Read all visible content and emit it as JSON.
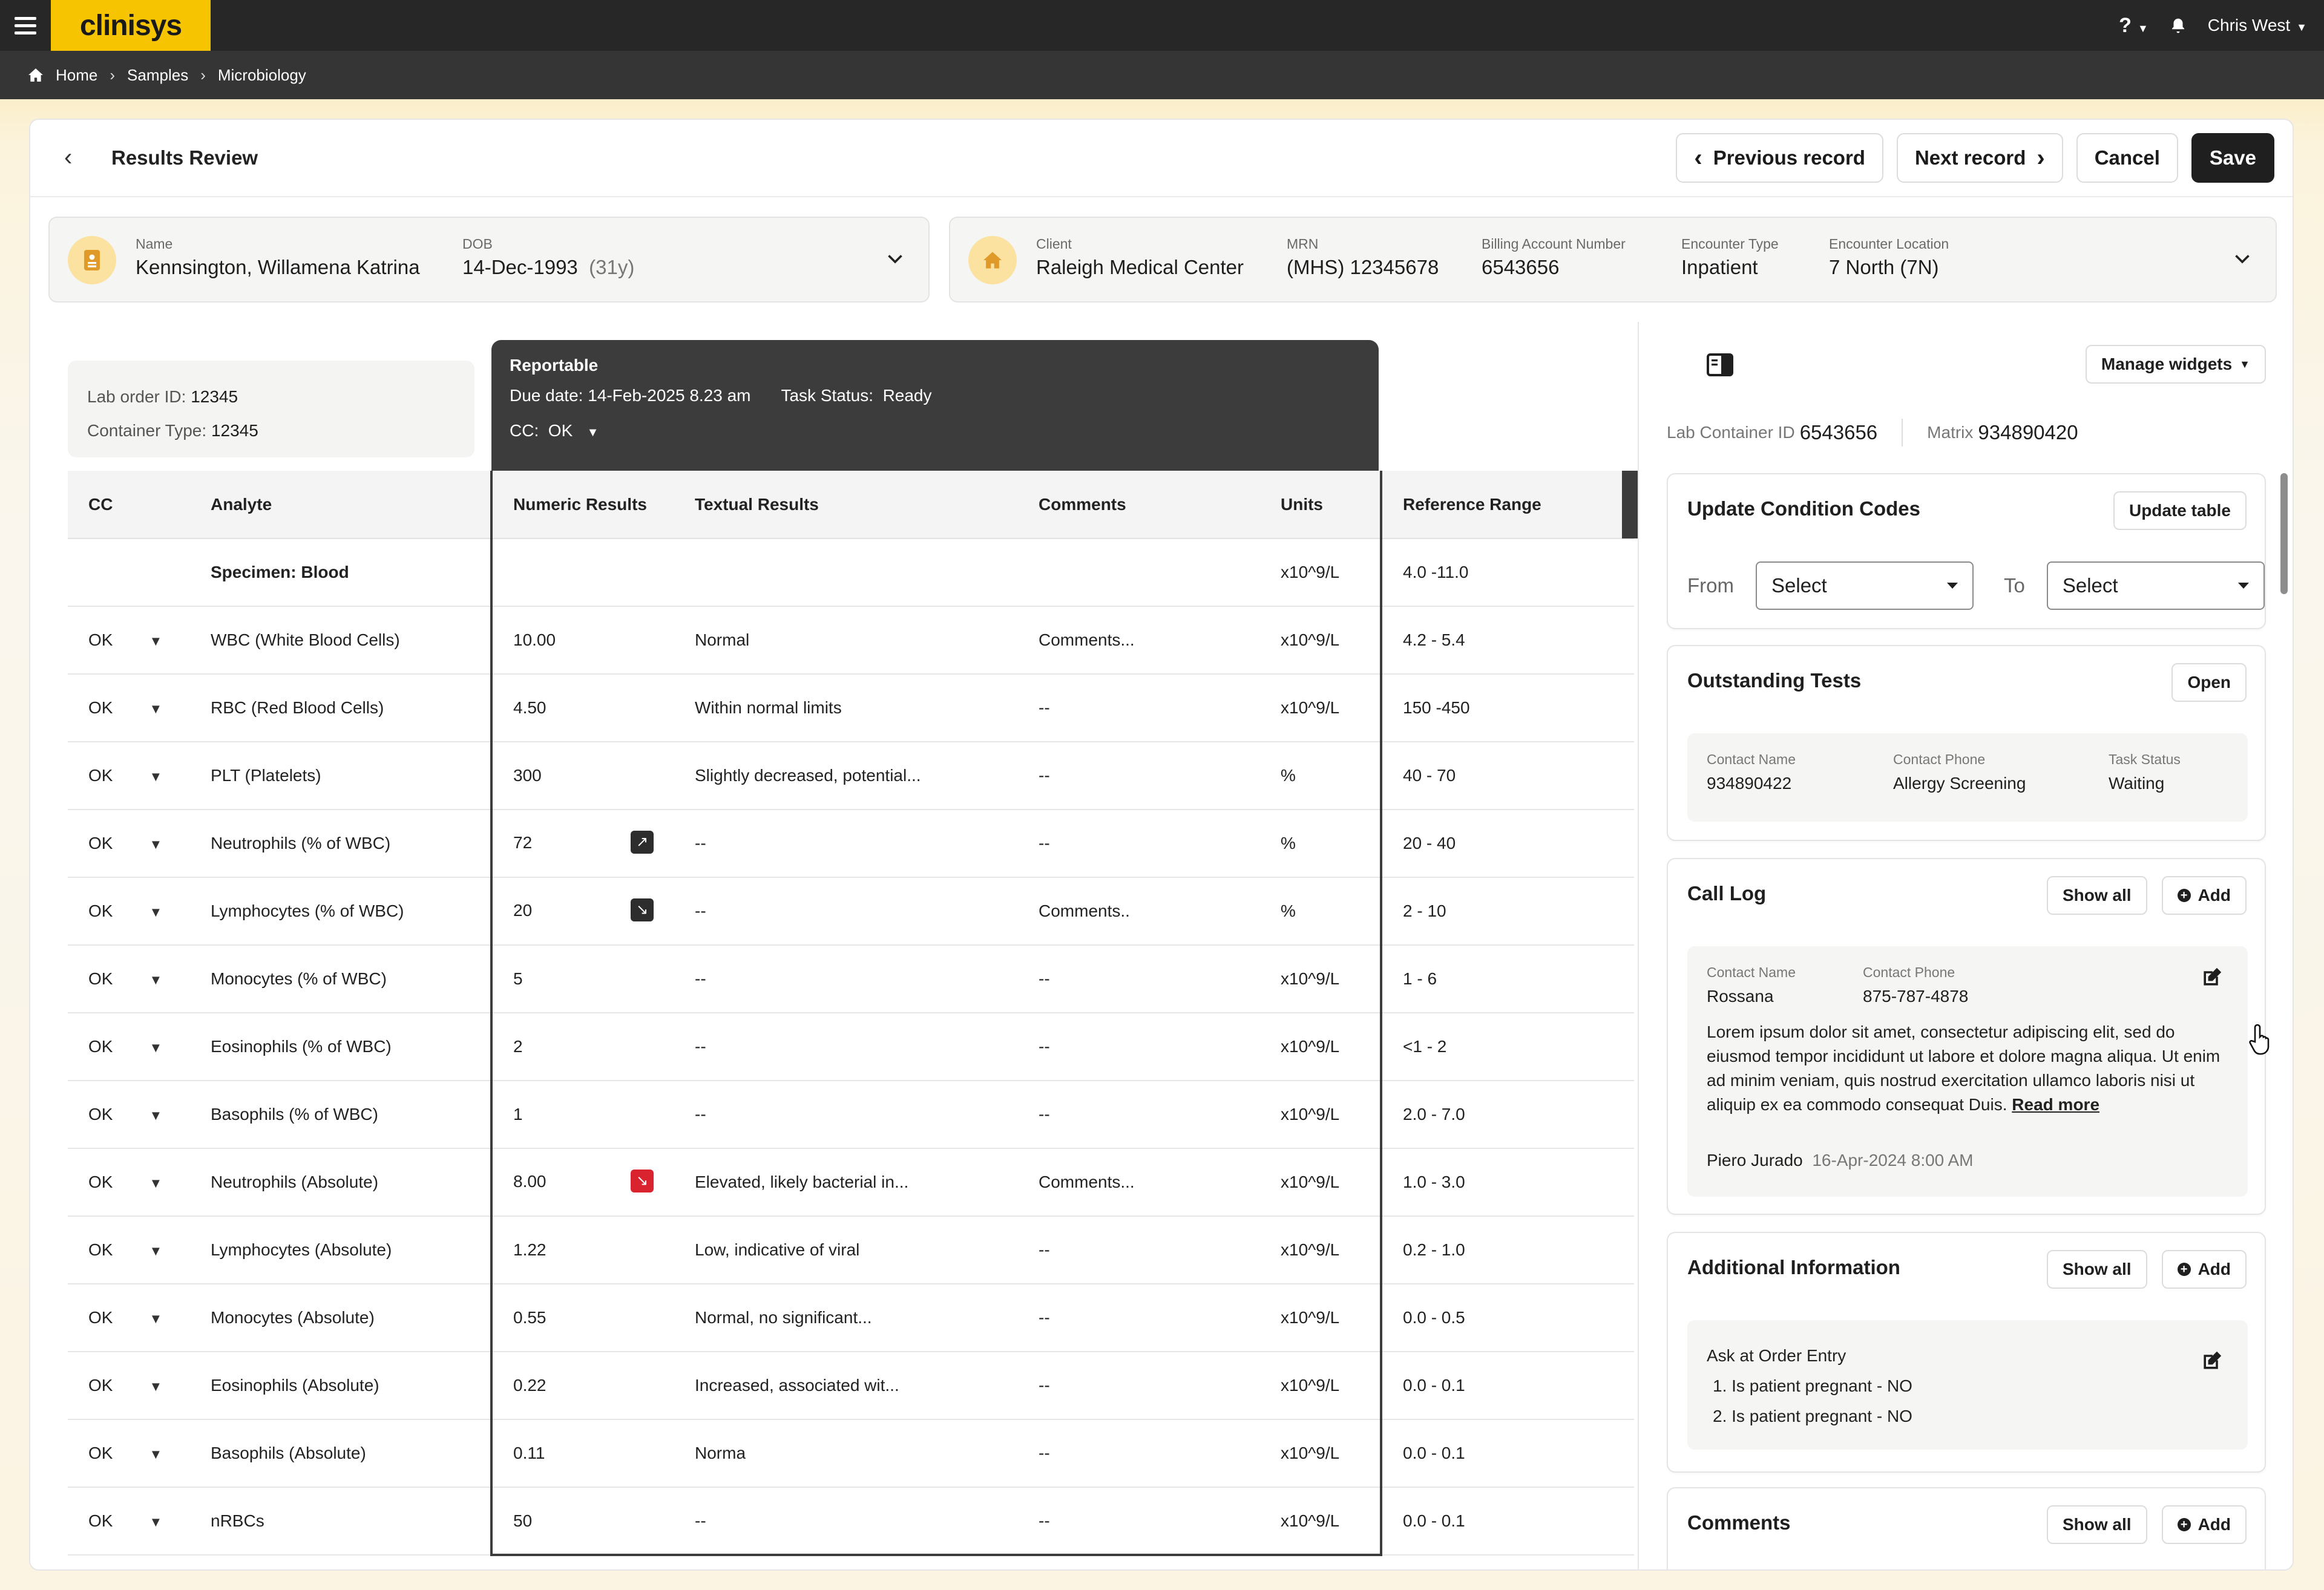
{
  "topbar": {
    "brand": "clinisys",
    "help": "?",
    "user": "Chris West"
  },
  "breadcrumb": [
    "Home",
    "Samples",
    "Microbiology"
  ],
  "header": {
    "title": "Results Review",
    "prev": "Previous record",
    "next": "Next record",
    "cancel": "Cancel",
    "save": "Save"
  },
  "patient": {
    "name_label": "Name",
    "name": "Kennsington, Willamena Katrina",
    "dob_label": "DOB",
    "dob": "14-Dec-1993",
    "age": "(31y)"
  },
  "client": {
    "client_label": "Client",
    "client": "Raleigh Medical Center",
    "mrn_label": "MRN",
    "mrn": "(MHS) 12345678",
    "billing_label": "Billing Account Number",
    "billing": "6543656",
    "enc_type_label": "Encounter Type",
    "enc_type": "Inpatient",
    "enc_loc_label": "Encounter Location",
    "enc_loc": "7 North (7N)"
  },
  "order": {
    "lab_order_label": "Lab order ID:",
    "lab_order": "12345",
    "container_label": "Container Type:",
    "container": "12345"
  },
  "reportable": {
    "title": "Reportable",
    "due_label": "Due date:",
    "due": "14-Feb-2025 8.23 am",
    "task_label": "Task Status:",
    "task": "Ready",
    "cc_label": "CC:",
    "cc": "OK"
  },
  "table": {
    "headers": [
      "CC",
      "Analyte",
      "Numeric Results",
      "Textual Results",
      "Comments",
      "Units",
      "Reference Range"
    ],
    "rows": [
      {
        "cc": "",
        "analyte": "Specimen: Blood",
        "numeric": "",
        "flag": "",
        "textual": "",
        "comments": "",
        "units": "x10^9/L",
        "range": "4.0 -11.0"
      },
      {
        "cc": "OK",
        "analyte": "WBC (White Blood Cells)",
        "numeric": "10.00",
        "flag": "",
        "textual": "Normal",
        "comments": "Comments...",
        "units": "x10^9/L",
        "range": "4.2 - 5.4"
      },
      {
        "cc": "OK",
        "analyte": "RBC (Red Blood Cells)",
        "numeric": "4.50",
        "flag": "",
        "textual": "Within normal limits",
        "comments": "--",
        "units": "x10^9/L",
        "range": "150 -450"
      },
      {
        "cc": "OK",
        "analyte": "PLT (Platelets)",
        "numeric": "300",
        "flag": "",
        "textual": "Slightly decreased, potential...",
        "comments": "--",
        "units": "%",
        "range": "40 - 70"
      },
      {
        "cc": "OK",
        "analyte": "Neutrophils (% of WBC)",
        "numeric": "72",
        "flag": "up-dark",
        "textual": "--",
        "comments": "--",
        "units": "%",
        "range": "20 - 40"
      },
      {
        "cc": "OK",
        "analyte": "Lymphocytes (% of WBC)",
        "numeric": "20",
        "flag": "down-dark",
        "textual": "--",
        "comments": "Comments..",
        "units": "%",
        "range": "2 - 10"
      },
      {
        "cc": "OK",
        "analyte": "Monocytes (% of WBC)",
        "numeric": "5",
        "flag": "",
        "textual": "--",
        "comments": "--",
        "units": "x10^9/L",
        "range": "1 - 6"
      },
      {
        "cc": "OK",
        "analyte": "Eosinophils (% of WBC)",
        "numeric": "2",
        "flag": "",
        "textual": "--",
        "comments": "--",
        "units": "x10^9/L",
        "range": "<1 - 2"
      },
      {
        "cc": "OK",
        "analyte": "Basophils (% of WBC)",
        "numeric": "1",
        "flag": "",
        "textual": "--",
        "comments": "--",
        "units": "x10^9/L",
        "range": "2.0 - 7.0"
      },
      {
        "cc": "OK",
        "analyte": "Neutrophils (Absolute)",
        "numeric": "8.00",
        "flag": "down-red",
        "textual": "Elevated, likely bacterial in...",
        "comments": "Comments...",
        "units": "x10^9/L",
        "range": "1.0 - 3.0"
      },
      {
        "cc": "OK",
        "analyte": "Lymphocytes (Absolute)",
        "numeric": "1.22",
        "flag": "",
        "textual": "Low, indicative of viral",
        "comments": "--",
        "units": "x10^9/L",
        "range": "0.2 - 1.0"
      },
      {
        "cc": "OK",
        "analyte": "Monocytes (Absolute)",
        "numeric": "0.55",
        "flag": "",
        "textual": "Normal, no significant...",
        "comments": "--",
        "units": "x10^9/L",
        "range": "0.0 - 0.5"
      },
      {
        "cc": "OK",
        "analyte": "Eosinophils (Absolute)",
        "numeric": "0.22",
        "flag": "",
        "textual": "Increased, associated wit...",
        "comments": "--",
        "units": "x10^9/L",
        "range": "0.0 - 0.1"
      },
      {
        "cc": "OK",
        "analyte": "Basophils (Absolute)",
        "numeric": "0.11",
        "flag": "",
        "textual": "Norma",
        "comments": "--",
        "units": "x10^9/L",
        "range": "0.0 - 0.1"
      },
      {
        "cc": "OK",
        "analyte": "nRBCs",
        "numeric": "50",
        "flag": "",
        "textual": "--",
        "comments": "--",
        "units": "x10^9/L",
        "range": "0.0 - 0.1"
      }
    ]
  },
  "sidebar": {
    "manage": "Manage widgets",
    "container_label": "Lab Container ID",
    "container": "6543656",
    "matrix_label": "Matrix",
    "matrix": "934890420",
    "condition": {
      "title": "Update Condition Codes",
      "update": "Update table",
      "from": "From",
      "to": "To",
      "from_value": "Select",
      "to_value": "Select"
    },
    "outstanding": {
      "title": "Outstanding Tests",
      "open": "Open",
      "c1_label": "Contact Name",
      "c1": "934890422",
      "c2_label": "Contact Phone",
      "c2": "Allergy Screening",
      "c3_label": "Task Status",
      "c3": "Waiting"
    },
    "calllog": {
      "title": "Call Log",
      "show_all": "Show all",
      "add": "Add",
      "name_label": "Contact Name",
      "name": "Rossana",
      "phone_label": "Contact Phone",
      "phone": "875-787-4878",
      "body": "Lorem ipsum dolor sit amet, consectetur adipiscing elit, sed do eiusmod tempor incididunt ut labore et dolore magna aliqua. Ut enim ad minim veniam, quis nostrud exercitation ullamco laboris nisi ut aliquip ex ea commodo consequat Duis.",
      "read_more": "Read more",
      "author": "Piero Jurado",
      "date": "16-Apr-2024 8:00 AM"
    },
    "additional": {
      "title": "Additional Information",
      "show_all": "Show all",
      "add": "Add",
      "heading": "Ask at Order Entry",
      "q1": "1.  Is patient pregnant - NO",
      "q2": "2.  Is patient pregnant - NO"
    },
    "comments": {
      "title": "Comments",
      "show_all": "Show all",
      "add": "Add"
    }
  },
  "colors": {
    "brand": "#f6c400",
    "topbar": "#272727",
    "flag_red": "#d9232e",
    "flag_dark": "#2d2d2d"
  }
}
